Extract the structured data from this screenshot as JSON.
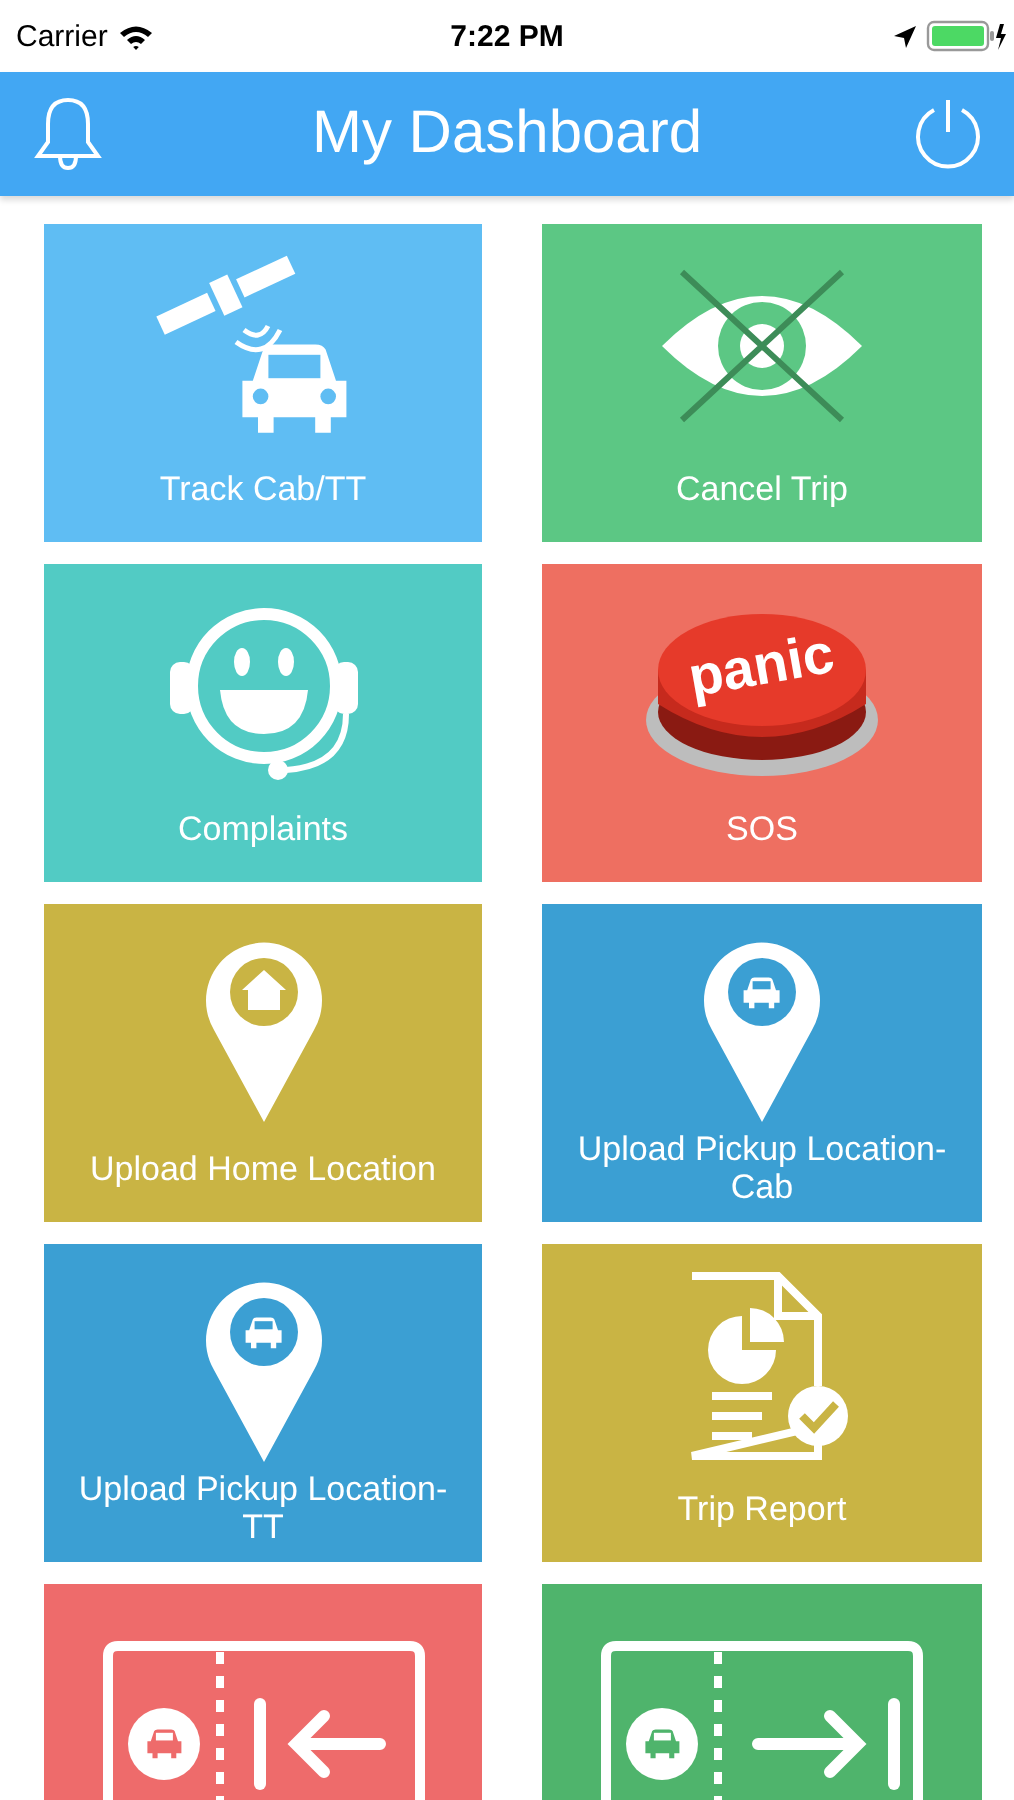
{
  "status_bar": {
    "carrier": "Carrier",
    "time": "7:22 PM"
  },
  "header": {
    "title": "My Dashboard"
  },
  "tiles": [
    {
      "label": "Track Cab/TT",
      "kind": "satellite-car",
      "color": "#5fbdf3"
    },
    {
      "label": "Cancel Trip",
      "kind": "crossed-eye",
      "color": "#5cc784"
    },
    {
      "label": "Complaints",
      "kind": "headset",
      "color": "#52cbc4"
    },
    {
      "label": "SOS",
      "kind": "panic",
      "color": "#ee6f61",
      "badge": "panic"
    },
    {
      "label": "Upload Home Location",
      "kind": "home-pin",
      "color": "#c9b444"
    },
    {
      "label": "Upload Pickup Location-Cab",
      "kind": "car-pin",
      "color": "#3b9fd3"
    },
    {
      "label": "Upload Pickup Location-TT",
      "kind": "car-pin",
      "color": "#3b9fd3"
    },
    {
      "label": "Trip Report",
      "kind": "report",
      "color": "#c9b444"
    },
    {
      "kind": "ticket-in",
      "color": "#ee6b6b"
    },
    {
      "kind": "ticket-out",
      "color": "#4fb46c"
    }
  ]
}
